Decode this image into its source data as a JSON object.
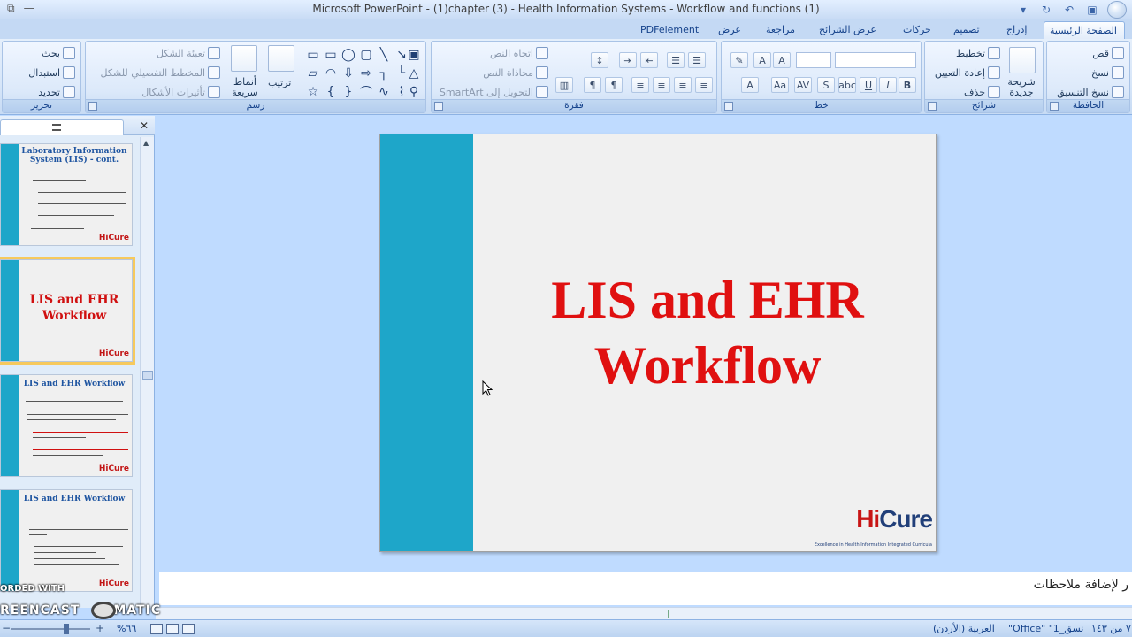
{
  "window": {
    "title": "Microsoft PowerPoint - (1)chapter (3) - Health Information Systems - Workflow and functions (1)"
  },
  "tabs": [
    {
      "label": "الصفحة الرئيسية",
      "active": true
    },
    {
      "label": "إدراج"
    },
    {
      "label": "تصميم"
    },
    {
      "label": "حركات"
    },
    {
      "label": "عرض الشرائح"
    },
    {
      "label": "مراجعة"
    },
    {
      "label": "عرض"
    },
    {
      "label": "PDFelement"
    }
  ],
  "ribbon": {
    "clipboard": {
      "label": "الحافظة",
      "cut": "قص",
      "copy": "نسخ",
      "format_painter": "نسخ التنسيق"
    },
    "slides": {
      "label": "شرائح",
      "new_slide": "شريحة جديدة",
      "layout": "تخطيط",
      "reset": "إعادة التعيين",
      "delete": "حذف"
    },
    "font": {
      "label": "خط"
    },
    "paragraph": {
      "label": "فقرة",
      "text_direction": "اتجاه النص",
      "align_text": "محاذاة النص",
      "smartart": "التحويل إلى SmartArt"
    },
    "drawing": {
      "label": "رسم",
      "arrange": "ترتيب",
      "quick_styles": "أنماط سريعة",
      "shape_fill": "تعبئة الشكل",
      "shape_outline": "المخطط التفصيلي للشكل",
      "shape_effects": "تأثيرات الأشكال"
    },
    "editing": {
      "label": "تحرير",
      "find": "بحث",
      "replace": "استبدال",
      "select": "تحديد"
    }
  },
  "slides_panel": {
    "thumbnails": [
      {
        "title": "Laboratory Information System (LIS) - cont.",
        "logo": "HiCure"
      },
      {
        "title": "LIS and EHR Workflow",
        "logo": "HiCure",
        "selected": true
      },
      {
        "title": "LIS and EHR Workflow",
        "logo": "HiCure"
      },
      {
        "title": "LIS and EHR Workflow",
        "logo": "HiCure"
      }
    ]
  },
  "slide": {
    "title": "LIS and EHR Workflow",
    "logo_text_a": "Hi",
    "logo_text_b": "Cure",
    "logo_tagline": "Excellence in Health Information Integrated Curricula",
    "accent_color": "#1ea6c9",
    "title_color": "#e01010"
  },
  "notes": {
    "placeholder": "ر لإضافة ملاحظات"
  },
  "status": {
    "slide_counter": "٧ من ١٤٣",
    "theme": "\"Office\" \"1_نسق",
    "language": "العربية (الأردن)",
    "zoom": "%٦٦"
  },
  "watermark": {
    "line1": "ORDED WITH",
    "line2": "REENCAST",
    "line2b": "MATIC"
  }
}
